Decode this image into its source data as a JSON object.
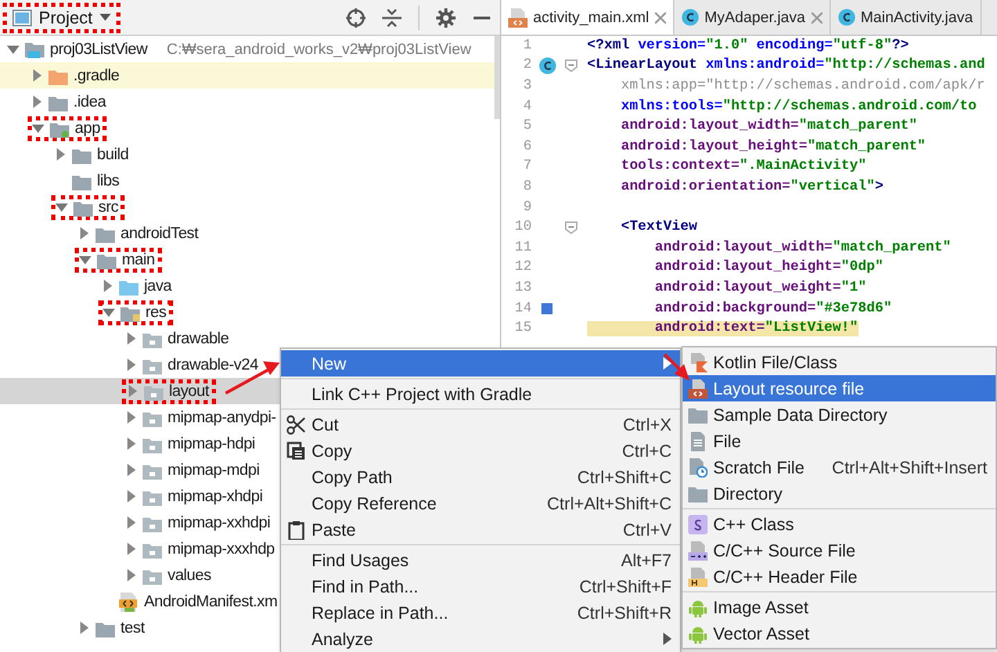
{
  "project_panel": {
    "title": "Project",
    "title_annotated": true,
    "tree": [
      {
        "name": "proj03ListView",
        "path": "C:₩sera_android_works_v2₩proj03ListView",
        "kind": "module",
        "expanded": true,
        "selected": false,
        "highlighted": false,
        "annotated": false,
        "children": [
          {
            "name": ".gradle",
            "kind": "gradle-folder",
            "expanded": false,
            "selected": false,
            "highlighted": true,
            "annotated": false
          },
          {
            "name": ".idea",
            "kind": "folder",
            "expanded": false,
            "selected": false,
            "highlighted": false,
            "annotated": false
          },
          {
            "name": "app",
            "kind": "module-folder",
            "expanded": true,
            "selected": false,
            "highlighted": false,
            "annotated": true,
            "children": [
              {
                "name": "build",
                "kind": "folder",
                "expanded": false,
                "selected": false,
                "highlighted": false,
                "annotated": false
              },
              {
                "name": "libs",
                "kind": "folder",
                "selected": false,
                "highlighted": false,
                "annotated": false
              },
              {
                "name": "src",
                "kind": "folder",
                "expanded": true,
                "selected": false,
                "highlighted": false,
                "annotated": true,
                "children": [
                  {
                    "name": "androidTest",
                    "kind": "folder",
                    "expanded": false,
                    "selected": false,
                    "highlighted": false,
                    "annotated": false
                  },
                  {
                    "name": "main",
                    "kind": "folder",
                    "expanded": true,
                    "selected": false,
                    "highlighted": false,
                    "annotated": true,
                    "children": [
                      {
                        "name": "java",
                        "kind": "source-folder",
                        "expanded": false,
                        "selected": false,
                        "highlighted": false,
                        "annotated": false
                      },
                      {
                        "name": "res",
                        "kind": "res-folder",
                        "expanded": true,
                        "selected": false,
                        "highlighted": false,
                        "annotated": true,
                        "children": [
                          {
                            "name": "drawable",
                            "kind": "package",
                            "expanded": false,
                            "selected": false,
                            "highlighted": false,
                            "annotated": false
                          },
                          {
                            "name": "drawable-v24",
                            "kind": "package",
                            "expanded": false,
                            "selected": false,
                            "highlighted": false,
                            "annotated": false
                          },
                          {
                            "name": "layout",
                            "kind": "package",
                            "expanded": false,
                            "selected": true,
                            "highlighted": false,
                            "annotated": true
                          },
                          {
                            "name": "mipmap-anydpi-",
                            "kind": "package",
                            "expanded": false,
                            "selected": false,
                            "highlighted": false,
                            "annotated": false
                          },
                          {
                            "name": "mipmap-hdpi",
                            "kind": "package",
                            "expanded": false,
                            "selected": false,
                            "highlighted": false,
                            "annotated": false
                          },
                          {
                            "name": "mipmap-mdpi",
                            "kind": "package",
                            "expanded": false,
                            "selected": false,
                            "highlighted": false,
                            "annotated": false
                          },
                          {
                            "name": "mipmap-xhdpi",
                            "kind": "package",
                            "expanded": false,
                            "selected": false,
                            "highlighted": false,
                            "annotated": false
                          },
                          {
                            "name": "mipmap-xxhdpi",
                            "kind": "package",
                            "expanded": false,
                            "selected": false,
                            "highlighted": false,
                            "annotated": false
                          },
                          {
                            "name": "mipmap-xxxhdp",
                            "kind": "package",
                            "expanded": false,
                            "selected": false,
                            "highlighted": false,
                            "annotated": false
                          },
                          {
                            "name": "values",
                            "kind": "package",
                            "expanded": false,
                            "selected": false,
                            "highlighted": false,
                            "annotated": false
                          }
                        ]
                      },
                      {
                        "name": "AndroidManifest.xm",
                        "kind": "manifest",
                        "selected": false,
                        "highlighted": false,
                        "annotated": false
                      }
                    ]
                  },
                  {
                    "name": "test",
                    "kind": "folder",
                    "expanded": false,
                    "selected": false,
                    "highlighted": false,
                    "annotated": false
                  }
                ]
              }
            ]
          }
        ]
      }
    ]
  },
  "editor": {
    "tabs": [
      {
        "label": "activity_main.xml",
        "kind": "xml",
        "selected": true,
        "closable": true
      },
      {
        "label": "MyAdaper.java",
        "kind": "class",
        "selected": false,
        "closable": true
      },
      {
        "label": "MainActivity.java",
        "kind": "class",
        "selected": false,
        "closable": false
      }
    ],
    "lines": [
      {
        "number": "1",
        "fold": false,
        "highlighted": false,
        "segments": [
          {
            "text": "<?xml ",
            "kind": "tag"
          },
          {
            "text": "version=",
            "kind": "ns"
          },
          {
            "text": "\"1.0\" ",
            "kind": "value"
          },
          {
            "text": "encoding=",
            "kind": "ns"
          },
          {
            "text": "\"utf-8\"",
            "kind": "value"
          },
          {
            "text": "?>",
            "kind": "tag"
          }
        ]
      },
      {
        "number": "2",
        "fold": true,
        "highlighted": false,
        "segments": [
          {
            "text": "<LinearLayout ",
            "kind": "tag"
          },
          {
            "text": "xmlns:android=",
            "kind": "ns"
          },
          {
            "text": "\"http://schemas.and",
            "kind": "value"
          }
        ]
      },
      {
        "number": "3",
        "fold": false,
        "highlighted": false,
        "segments": [
          {
            "text": "    xmlns:app=\"http://schemas.android.com/apk/r",
            "kind": "dim"
          }
        ]
      },
      {
        "number": "4",
        "fold": false,
        "highlighted": false,
        "segments": [
          {
            "text": "    xmlns:tools=",
            "kind": "ns"
          },
          {
            "text": "\"http://schemas.android.com/to",
            "kind": "value"
          }
        ]
      },
      {
        "number": "5",
        "fold": false,
        "highlighted": false,
        "segments": [
          {
            "text": "    android:layout_width=",
            "kind": "attr"
          },
          {
            "text": "\"match_parent\"",
            "kind": "value"
          }
        ]
      },
      {
        "number": "6",
        "fold": false,
        "highlighted": false,
        "segments": [
          {
            "text": "    android:layout_height=",
            "kind": "attr"
          },
          {
            "text": "\"match_parent\"",
            "kind": "value"
          }
        ]
      },
      {
        "number": "7",
        "fold": false,
        "highlighted": false,
        "segments": [
          {
            "text": "    tools:context=",
            "kind": "attr"
          },
          {
            "text": "\".MainActivity\"",
            "kind": "value"
          }
        ]
      },
      {
        "number": "8",
        "fold": false,
        "highlighted": false,
        "segments": [
          {
            "text": "    android:orientation=",
            "kind": "attr"
          },
          {
            "text": "\"vertical\"",
            "kind": "value"
          },
          {
            "text": ">",
            "kind": "tag"
          }
        ]
      },
      {
        "number": "9",
        "fold": false,
        "highlighted": false
      },
      {
        "number": "10",
        "fold": true,
        "highlighted": false,
        "segments": [
          {
            "text": "    <TextView",
            "kind": "tag"
          }
        ]
      },
      {
        "number": "11",
        "fold": false,
        "highlighted": false,
        "segments": [
          {
            "text": "        android:layout_width=",
            "kind": "attr"
          },
          {
            "text": "\"match_parent\"",
            "kind": "value"
          }
        ]
      },
      {
        "number": "12",
        "fold": false,
        "highlighted": false,
        "segments": [
          {
            "text": "        android:layout_height=",
            "kind": "attr"
          },
          {
            "text": "\"0dp\"",
            "kind": "value"
          }
        ]
      },
      {
        "number": "13",
        "fold": false,
        "highlighted": false,
        "segments": [
          {
            "text": "        android:layout_weight=",
            "kind": "attr"
          },
          {
            "text": "\"1\"",
            "kind": "value"
          }
        ]
      },
      {
        "number": "14",
        "fold": false,
        "highlighted": false,
        "segments": [
          {
            "text": "        android:background=",
            "kind": "attr"
          },
          {
            "text": "\"#3e78d6\"",
            "kind": "value"
          }
        ]
      },
      {
        "number": "15",
        "fold": false,
        "highlighted": true,
        "segments": [
          {
            "text": "        android:text=",
            "kind": "attr"
          },
          {
            "text": "\"ListView!\"",
            "kind": "value"
          }
        ]
      }
    ]
  },
  "context_menu": {
    "groups": [
      [
        {
          "label": "New",
          "selected": true,
          "submenu": true
        }
      ],
      [
        {
          "label": "Link C++ Project with Gradle",
          "selected": false,
          "submenu": false
        }
      ],
      [
        {
          "label": "Cut",
          "shortcut": "Ctrl+X",
          "selected": false,
          "submenu": false
        },
        {
          "label": "Copy",
          "shortcut": "Ctrl+C",
          "selected": false,
          "submenu": false
        },
        {
          "label": "Copy Path",
          "shortcut": "Ctrl+Shift+C",
          "selected": false,
          "submenu": false
        },
        {
          "label": "Copy Reference",
          "shortcut": "Ctrl+Alt+Shift+C",
          "selected": false,
          "submenu": false
        },
        {
          "label": "Paste",
          "shortcut": "Ctrl+V",
          "selected": false,
          "submenu": false
        }
      ],
      [
        {
          "label": "Find Usages",
          "shortcut": "Alt+F7",
          "selected": false,
          "submenu": false
        },
        {
          "label": "Find in Path...",
          "shortcut": "Ctrl+Shift+F",
          "selected": false,
          "submenu": false
        },
        {
          "label": "Replace in Path...",
          "shortcut": "Ctrl+Shift+R",
          "selected": false,
          "submenu": false
        },
        {
          "label": "Analyze",
          "selected": false,
          "submenu": true
        }
      ]
    ]
  },
  "submenu": {
    "groups": [
      [
        {
          "label": "Kotlin File/Class",
          "selected": false,
          "submenu": false
        },
        {
          "label": "Layout resource file",
          "selected": true,
          "submenu": false
        },
        {
          "label": "Sample Data Directory",
          "selected": false,
          "submenu": false
        },
        {
          "label": "File",
          "selected": false,
          "submenu": false
        },
        {
          "label": "Scratch File",
          "shortcut": "Ctrl+Alt+Shift+Insert",
          "selected": false,
          "submenu": false
        },
        {
          "label": "Directory",
          "selected": false,
          "submenu": false
        }
      ],
      [
        {
          "label": "C++ Class",
          "selected": false,
          "submenu": false
        },
        {
          "label": "C/C++ Source File",
          "selected": false,
          "submenu": false
        },
        {
          "label": "C/C++ Header File",
          "selected": false,
          "submenu": false
        }
      ],
      [
        {
          "label": "Image Asset",
          "selected": false,
          "submenu": false
        },
        {
          "label": "Vector Asset",
          "selected": false,
          "submenu": false
        }
      ]
    ]
  }
}
